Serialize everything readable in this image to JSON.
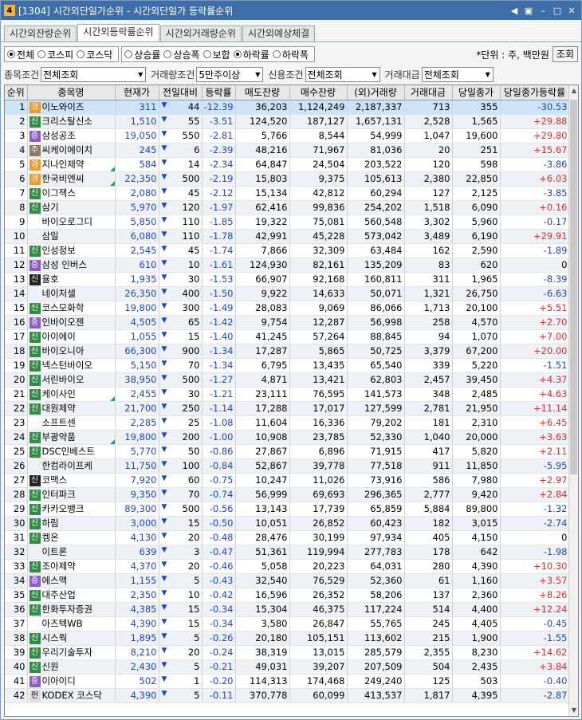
{
  "window": {
    "badge": "4",
    "title": "[1304] 시간외단일가순위 - 시간외단일가 등락률순위"
  },
  "tabs": [
    "시간외잔량순위",
    "시간외등락률순위",
    "시간외거래량순위",
    "시간외예상체결"
  ],
  "market_radios": [
    {
      "label": "전체",
      "on": true
    },
    {
      "label": "코스피",
      "on": false
    },
    {
      "label": "코스닥",
      "on": false
    }
  ],
  "rank_radios": [
    {
      "label": "상승률",
      "on": false
    },
    {
      "label": "상승폭",
      "on": false
    },
    {
      "label": "보합",
      "on": false
    },
    {
      "label": "하락률",
      "on": true
    },
    {
      "label": "하락폭",
      "on": false
    }
  ],
  "unit_text": "*단위 : 주, 백만원",
  "query_button": "조회",
  "filters": [
    {
      "label": "종목조건",
      "value": "전체조회"
    },
    {
      "label": "거래량조건",
      "value": "5만주이상"
    },
    {
      "label": "신용조건",
      "value": "전체조회"
    },
    {
      "label": "거래대금",
      "value": "전체조회"
    }
  ],
  "columns": [
    "순위",
    "종목명",
    "현재가",
    "전일대비",
    "등락률",
    "매도잔량",
    "매수잔량",
    "(외)거래량",
    "거래대금",
    "당일종가",
    "당일종가등락률"
  ],
  "rows": [
    [
      "1",
      "경",
      "이노와이즈",
      "311",
      "44",
      "-12.39",
      "36,203",
      "1,124,249",
      "2,187,337",
      "713",
      "355",
      "-30.53"
    ],
    [
      "2",
      "신",
      "크리스탈신소",
      "1,510",
      "55",
      "-3.51",
      "124,520",
      "187,127",
      "1,657,131",
      "2,528",
      "1,565",
      "+29.88"
    ],
    [
      "3",
      "증",
      "삼성공조",
      "19,050",
      "550",
      "-2.81",
      "5,766",
      "8,544",
      "54,999",
      "1,047",
      "19,600",
      "+29.80"
    ],
    [
      "4",
      "주",
      "씨케이에이치",
      "245",
      "6",
      "-2.39",
      "48,216",
      "71,967",
      "81,036",
      "20",
      "251",
      "+15.67"
    ],
    [
      "5",
      "경",
      "지나인제약",
      "584",
      "14",
      "-2.34",
      "64,847",
      "24,504",
      "203,522",
      "120",
      "598",
      "-3.86"
    ],
    [
      "6",
      "경",
      "한국비엔씨",
      "22,350",
      "500",
      "-2.19",
      "15,803",
      "9,375",
      "105,613",
      "2,380",
      "22,850",
      "+6.03"
    ],
    [
      "7",
      "신",
      "이그잭스",
      "2,080",
      "45",
      "-2.12",
      "15,134",
      "42,812",
      "60,294",
      "127",
      "2,125",
      "-3.85"
    ],
    [
      "8",
      "신",
      "삼기",
      "5,970",
      "120",
      "-1.97",
      "62,416",
      "99,836",
      "254,202",
      "1,518",
      "6,090",
      "+0.16"
    ],
    [
      "9",
      "",
      "바이오로그디",
      "5,850",
      "110",
      "-1.85",
      "19,322",
      "75,081",
      "560,548",
      "3,302",
      "5,960",
      "-0.17"
    ],
    [
      "10",
      "",
      "삼일",
      "6,080",
      "110",
      "-1.78",
      "42,991",
      "45,228",
      "573,042",
      "3,489",
      "6,190",
      "+29.91"
    ],
    [
      "11",
      "신",
      "인성정보",
      "2,545",
      "45",
      "-1.74",
      "7,866",
      "32,309",
      "63,484",
      "162",
      "2,590",
      "-1.89"
    ],
    [
      "12",
      "증",
      "삼성 인버스",
      "610",
      "10",
      "-1.61",
      "124,930",
      "82,161",
      "135,209",
      "83",
      "620",
      "0"
    ],
    [
      "13",
      "신",
      "율호",
      "1,935",
      "30",
      "-1.53",
      "66,907",
      "92,168",
      "160,811",
      "311",
      "1,965",
      "-8.39"
    ],
    [
      "14",
      "",
      "네이처셀",
      "26,350",
      "400",
      "-1.50",
      "9,922",
      "14,633",
      "50,071",
      "1,321",
      "26,750",
      "-6.63"
    ],
    [
      "15",
      "신",
      "코스모화학",
      "19,800",
      "300",
      "-1.49",
      "28,083",
      "9,069",
      "86,066",
      "1,713",
      "20,100",
      "+5.51"
    ],
    [
      "16",
      "증",
      "인바이오젠",
      "4,505",
      "65",
      "-1.42",
      "9,754",
      "12,287",
      "56,998",
      "258",
      "4,570",
      "+2.70"
    ],
    [
      "17",
      "신",
      "아이에이",
      "1,055",
      "15",
      "-1.40",
      "41,245",
      "57,264",
      "88,845",
      "94",
      "1,070",
      "+7.00"
    ],
    [
      "18",
      "신",
      "바이오니아",
      "66,300",
      "900",
      "-1.34",
      "17,287",
      "5,865",
      "50,725",
      "3,379",
      "67,200",
      "+20.00"
    ],
    [
      "19",
      "신",
      "넥스턴바이오",
      "5,150",
      "70",
      "-1.34",
      "6,795",
      "13,435",
      "65,540",
      "339",
      "5,220",
      "-1.51"
    ],
    [
      "20",
      "신",
      "서린바이오",
      "38,950",
      "500",
      "-1.27",
      "4,871",
      "13,421",
      "62,803",
      "2,457",
      "39,450",
      "+4.37"
    ],
    [
      "21",
      "신",
      "케이사인",
      "2,455",
      "30",
      "-1.21",
      "23,111",
      "76,595",
      "141,573",
      "348",
      "2,485",
      "+4.63"
    ],
    [
      "22",
      "신",
      "대원제약",
      "21,700",
      "250",
      "-1.14",
      "17,288",
      "17,017",
      "127,599",
      "2,781",
      "21,950",
      "+11.14"
    ],
    [
      "23",
      "",
      "소프트센",
      "2,285",
      "25",
      "-1.08",
      "11,604",
      "16,336",
      "79,202",
      "181",
      "2,310",
      "+6.45"
    ],
    [
      "24",
      "신",
      "부광약품",
      "19,800",
      "200",
      "-1.00",
      "10,908",
      "23,785",
      "52,330",
      "1,040",
      "20,000",
      "+3.63"
    ],
    [
      "25",
      "신",
      "DSC인베스트",
      "5,770",
      "50",
      "-0.86",
      "27,867",
      "6,896",
      "71,915",
      "417",
      "5,820",
      "+2.11"
    ],
    [
      "26",
      "",
      "한컴라이프케",
      "11,750",
      "100",
      "-0.84",
      "52,867",
      "39,778",
      "77,518",
      "911",
      "11,850",
      "-5.95"
    ],
    [
      "27",
      "신",
      "코맥스",
      "7,920",
      "60",
      "-0.75",
      "10,247",
      "11,026",
      "73,916",
      "586",
      "7,980",
      "+2.97"
    ],
    [
      "28",
      "신",
      "인터파크",
      "9,350",
      "70",
      "-0.74",
      "56,999",
      "69,693",
      "296,365",
      "2,777",
      "9,420",
      "+2.84"
    ],
    [
      "29",
      "신",
      "카카오뱅크",
      "89,300",
      "500",
      "-0.56",
      "13,143",
      "17,739",
      "65,859",
      "5,884",
      "89,800",
      "-1.32"
    ],
    [
      "30",
      "신",
      "하림",
      "3,000",
      "15",
      "-0.50",
      "10,051",
      "26,852",
      "60,423",
      "182",
      "3,015",
      "-2.74"
    ],
    [
      "31",
      "신",
      "켐온",
      "4,130",
      "20",
      "-0.48",
      "28,476",
      "30,199",
      "97,934",
      "405",
      "4,150",
      "0"
    ],
    [
      "32",
      "",
      "이트론",
      "639",
      "3",
      "-0.47",
      "51,361",
      "119,994",
      "277,783",
      "178",
      "642",
      "-1.98"
    ],
    [
      "33",
      "신",
      "조아제약",
      "4,370",
      "20",
      "-0.46",
      "5,058",
      "20,223",
      "64,031",
      "280",
      "4,390",
      "+10.30"
    ],
    [
      "34",
      "증",
      "에스맥",
      "1,155",
      "5",
      "-0.43",
      "32,540",
      "76,529",
      "52,360",
      "61",
      "1,160",
      "+3.57"
    ],
    [
      "35",
      "신",
      "대주산업",
      "2,350",
      "10",
      "-0.42",
      "16,596",
      "26,352",
      "58,206",
      "137",
      "2,360",
      "+8.26"
    ],
    [
      "36",
      "신",
      "한화투자증권",
      "4,385",
      "15",
      "-0.34",
      "15,304",
      "46,375",
      "117,224",
      "514",
      "4,400",
      "+12.24"
    ],
    [
      "37",
      "",
      "아즈텍WB",
      "4,390",
      "15",
      "-0.34",
      "3,580",
      "26,847",
      "55,765",
      "245",
      "4,405",
      "-0.45"
    ],
    [
      "38",
      "신",
      "시스웍",
      "1,895",
      "5",
      "-0.26",
      "20,180",
      "105,151",
      "113,602",
      "215",
      "1,900",
      "-1.55"
    ],
    [
      "39",
      "신",
      "우리기술투자",
      "8,210",
      "20",
      "-0.24",
      "38,319",
      "13,015",
      "285,579",
      "2,355",
      "8,230",
      "+14.62"
    ],
    [
      "40",
      "신",
      "신원",
      "2,430",
      "5",
      "-0.21",
      "49,031",
      "39,207",
      "207,509",
      "504",
      "2,435",
      "+3.84"
    ],
    [
      "41",
      "증",
      "이아이디",
      "502",
      "1",
      "-0.20",
      "114,313",
      "174,468",
      "249,240",
      "125",
      "503",
      "-0.40"
    ],
    [
      "42",
      "펀",
      "KODEX 코스닥",
      "4,390",
      "5",
      "-0.11",
      "370,778",
      "60,099",
      "413,537",
      "1,817",
      "4,395",
      "-2.87"
    ]
  ],
  "badge_styles": {
    "경": "b-warn",
    "신": "b-shin",
    "증": "b-caution",
    "주": "b-wae",
    "펀": "b-pyeon"
  },
  "colors": {
    "up": "#e12a2a",
    "down": "#1b47c6",
    "title_bar": "#3d6ea8",
    "selected_row": "#cde3f7"
  }
}
